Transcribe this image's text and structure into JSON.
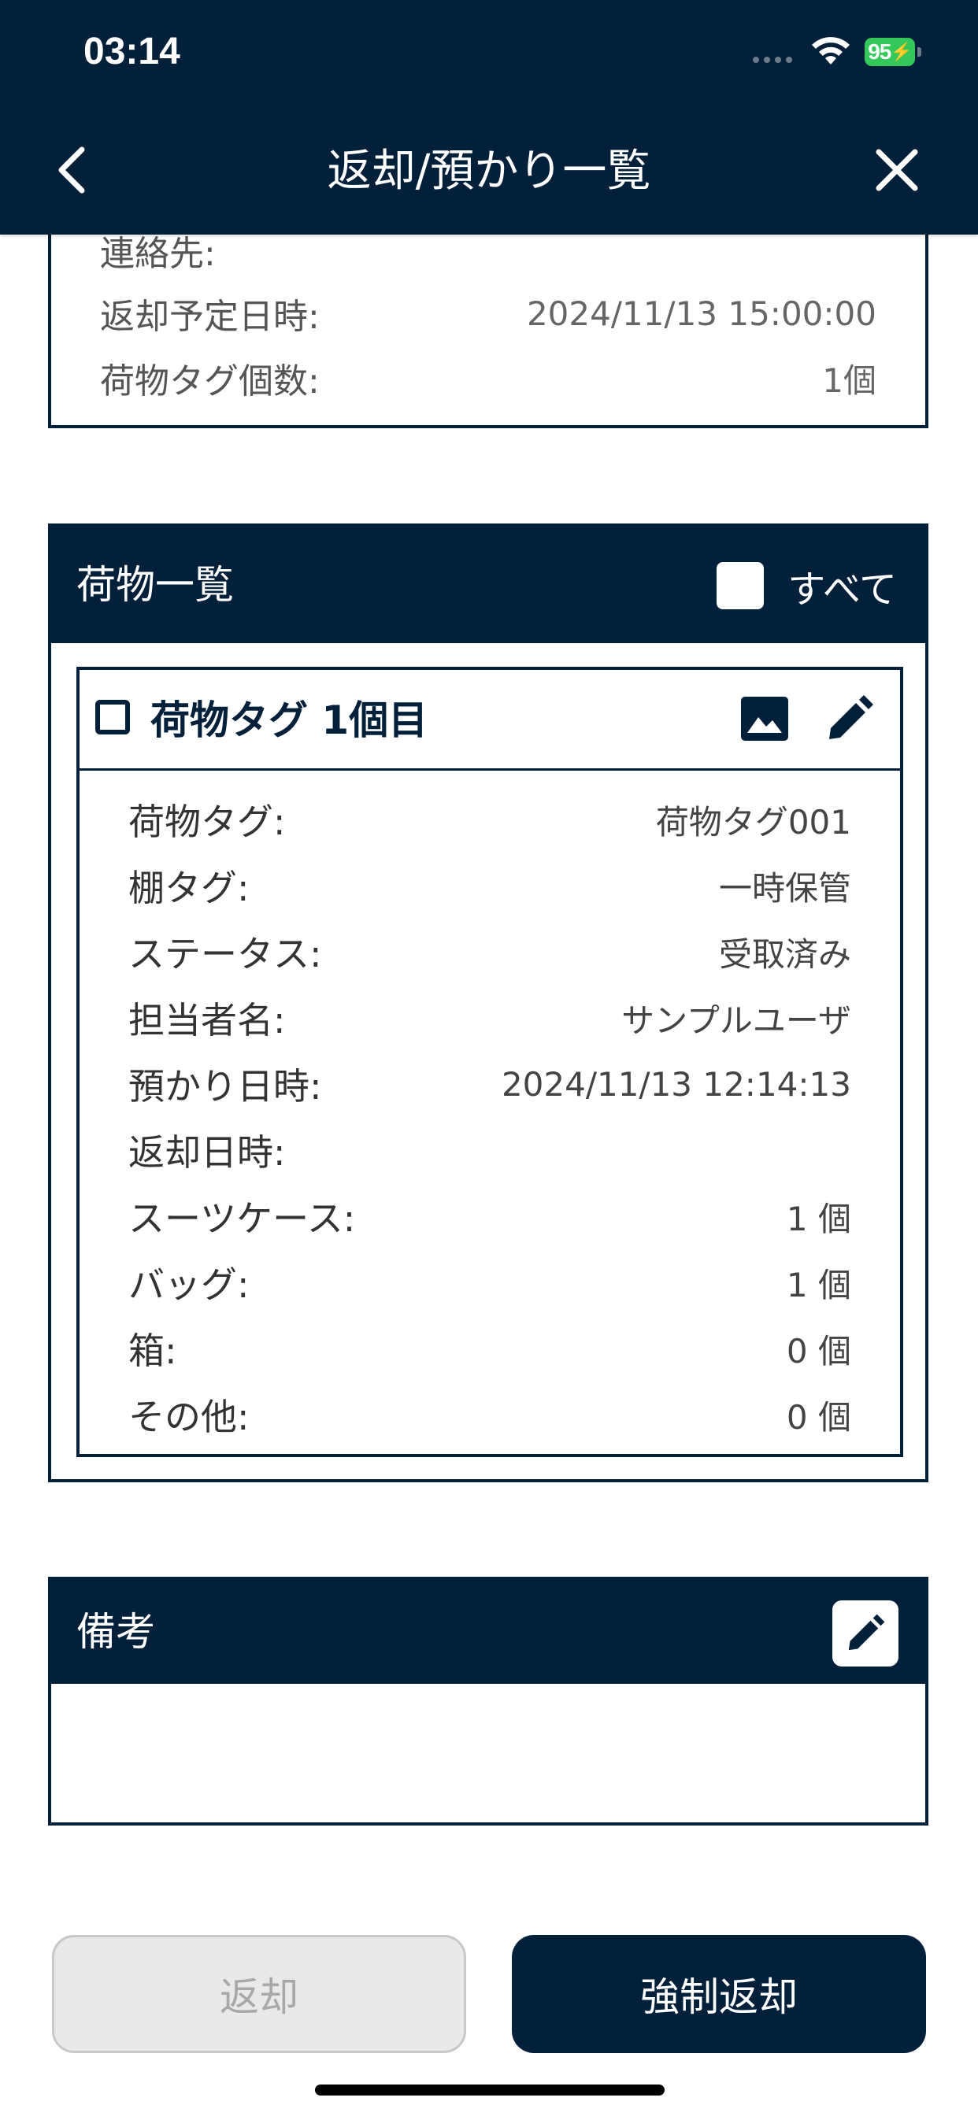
{
  "status_bar": {
    "time": "03:14",
    "battery": "95"
  },
  "header": {
    "title": "返却/預かり一覧",
    "back_icon": "chevron-left-icon",
    "close_icon": "close-icon"
  },
  "summary": {
    "rows": [
      {
        "label": "連絡先:",
        "value": ""
      },
      {
        "label": "返却予定日時:",
        "value": "2024/11/13 15:00:00"
      },
      {
        "label": "荷物タグ個数:",
        "value": "1個"
      }
    ]
  },
  "luggage": {
    "title": "荷物一覧",
    "select_all_label": "すべて",
    "tag_card": {
      "title": "荷物タグ 1個目",
      "image_icon": "image-icon",
      "edit_icon": "pencil-icon",
      "rows": [
        {
          "label": "荷物タグ:",
          "value": "荷物タグ001"
        },
        {
          "label": "棚タグ:",
          "value": "一時保管"
        },
        {
          "label": "ステータス:",
          "value": "受取済み"
        },
        {
          "label": "担当者名:",
          "value": "サンプルユーザ"
        },
        {
          "label": "預かり日時:",
          "value": "2024/11/13 12:14:13"
        },
        {
          "label": "返却日時:",
          "value": ""
        },
        {
          "label": "スーツケース:",
          "value": "1 個"
        },
        {
          "label": "バッグ:",
          "value": "1 個"
        },
        {
          "label": "箱:",
          "value": "0 個"
        },
        {
          "label": "その他:",
          "value": "0 個"
        }
      ]
    }
  },
  "notes": {
    "title": "備考",
    "edit_icon": "pencil-icon",
    "content": ""
  },
  "footer": {
    "return_label": "返却",
    "force_return_label": "強制返却"
  },
  "colors": {
    "primary": "#02203a",
    "disabled_bg": "#e9e9e9",
    "disabled_text": "#a8a8a8",
    "battery": "#34c759"
  }
}
